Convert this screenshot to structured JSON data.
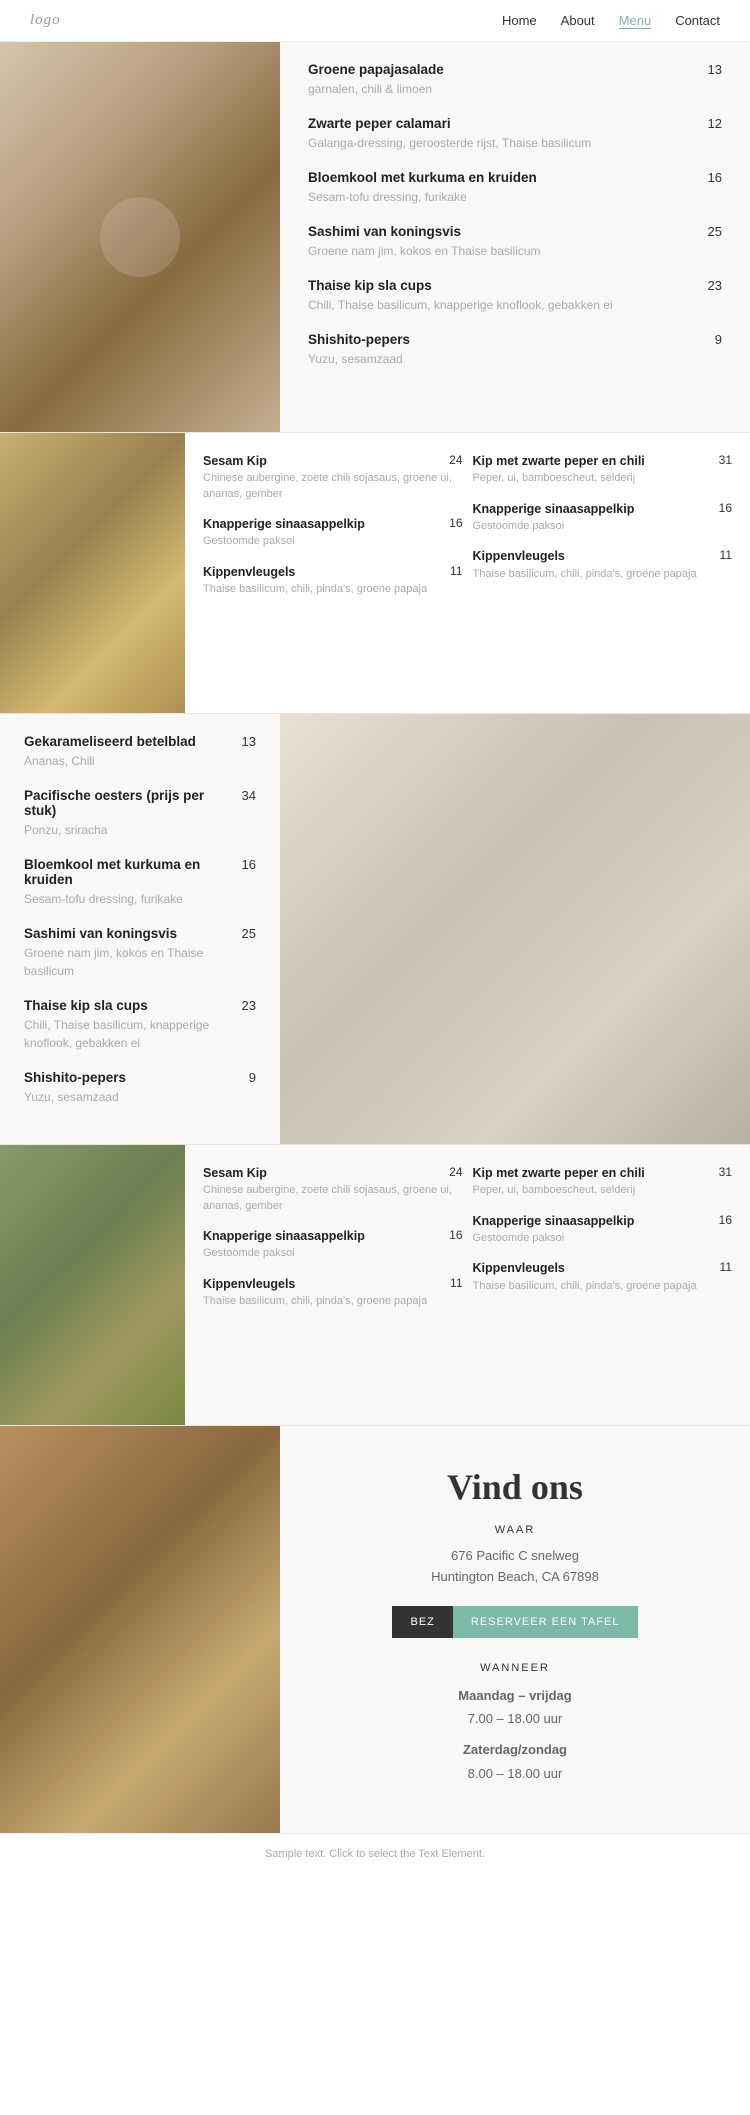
{
  "nav": {
    "logo": "logo",
    "links": [
      {
        "label": "Home",
        "active": false
      },
      {
        "label": "About",
        "active": false
      },
      {
        "label": "Menu",
        "active": true
      },
      {
        "label": "Contact",
        "active": false
      }
    ]
  },
  "section1": {
    "items": [
      {
        "name": "Groene papajasalade",
        "price": "13",
        "desc": "garnalen, chili & limoen"
      },
      {
        "name": "Zwarte peper calamari",
        "price": "12",
        "desc": "Galanga-dressing, geroosterde rijst, Thaise basilicum"
      },
      {
        "name": "Bloemkool met kurkuma en kruiden",
        "price": "16",
        "desc": "Sesam-tofu dressing, furikake"
      },
      {
        "name": "Sashimi van koningsvis",
        "price": "25",
        "desc": "Groene nam jim, kokos en Thaise basilicum"
      },
      {
        "name": "Thaise kip sla cups",
        "price": "23",
        "desc": "Chili, Thaise basilicum, knapperige knoflook, gebakken ei"
      },
      {
        "name": "Shishito-pepers",
        "price": "9",
        "desc": "Yuzu, sesamzaad"
      }
    ]
  },
  "section2": {
    "left_col": [
      {
        "name": "Sesam Kip",
        "price": "24",
        "desc": "Chinese aubergine, zoete chili sojasaus, groene ui, ananas, gember"
      },
      {
        "name": "Knapperige sinaasappelkip",
        "price": "16",
        "desc": "Gestoomde paksoi"
      },
      {
        "name": "Kippenvleugels",
        "price": "11",
        "desc": "Thaise basilicum, chili, pinda's, groene papaja"
      }
    ],
    "right_col": [
      {
        "name": "Kip met zwarte peper en chili",
        "price": "31",
        "desc": "Peper, ui, bamboescheut, selderij"
      },
      {
        "name": "Knapperige sinaasappelkip",
        "price": "16",
        "desc": "Gestoomde paksoi"
      },
      {
        "name": "Kippenvleugels",
        "price": "11",
        "desc": "Thaise basilicum, chili, pinda's, groene papaja"
      }
    ]
  },
  "section3": {
    "items": [
      {
        "name": "Gekarameliseerd betelblad",
        "price": "13",
        "desc": "Ananas, Chili"
      },
      {
        "name": "Pacifische oesters (prijs per stuk)",
        "price": "34",
        "desc": "Ponzu, sriracha"
      },
      {
        "name": "Bloemkool met kurkuma en kruiden",
        "price": "16",
        "desc": "Sesam-tofu dressing, furikake"
      },
      {
        "name": "Sashimi van koningsvis",
        "price": "25",
        "desc": "Groene nam jim, kokos en Thaise basilicum"
      },
      {
        "name": "Thaise kip sla cups",
        "price": "23",
        "desc": "Chili, Thaise basilicum, knapperige knoflook, gebakken ei"
      },
      {
        "name": "Shishito-pepers",
        "price": "9",
        "desc": "Yuzu, sesamzaad"
      }
    ]
  },
  "section4": {
    "left_col": [
      {
        "name": "Sesam Kip",
        "price": "24",
        "desc": "Chinese aubergine, zoete chili sojasaus, groene ui, ananas, gember"
      },
      {
        "name": "Knapperige sinaasappelkip",
        "price": "16",
        "desc": "Gestoomde paksoi"
      },
      {
        "name": "Kippenvleugels",
        "price": "11",
        "desc": "Thaise basilicum, chili, pinda's, groene papaja"
      }
    ],
    "right_col": [
      {
        "name": "Kip met zwarte peper en chili",
        "price": "31",
        "desc": "Peper, ui, bamboescheut, selderij"
      },
      {
        "name": "Knapperige sinaasappelkip",
        "price": "16",
        "desc": "Gestoomde paksoi"
      },
      {
        "name": "Kippenvleugels",
        "price": "11",
        "desc": "Thaise basilicum, chili, pinda's, groene papaja"
      }
    ]
  },
  "findus": {
    "title": "Vind ons",
    "where_label": "WAAR",
    "address_line1": "676 Pacific C snelweg",
    "address_line2": "Huntington Beach, CA 67898",
    "btn_visit": "BEZ",
    "btn_reserve": "RESERVEER EEN TAFEL",
    "when_label": "WANNEER",
    "hours": [
      {
        "days": "Maandag – vrijdag",
        "time": "7.00 – 18.00 uur"
      },
      {
        "days": "Zaterdag/zondag",
        "time": "8.00 – 18.00 uur"
      }
    ]
  },
  "footer": {
    "note": "Sample text. Click to select the Text Element."
  }
}
